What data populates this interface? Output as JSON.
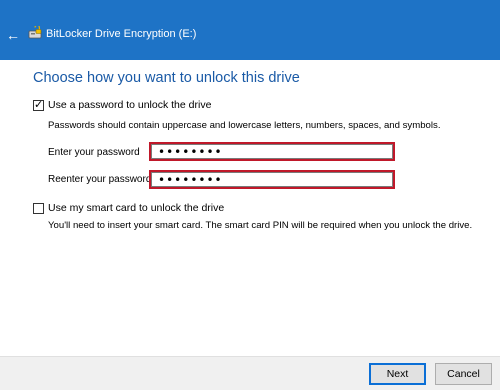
{
  "window": {
    "title": "BitLocker Drive Encryption (E:)"
  },
  "main": {
    "heading": "Choose how you want to unlock this drive",
    "password_option": {
      "label": "Use a password to unlock the drive",
      "checked": true,
      "description": "Passwords should contain uppercase and lowercase letters, numbers, spaces, and symbols.",
      "enter_label": "Enter your password",
      "enter_value": "••••••••",
      "reenter_label": "Reenter your password",
      "reenter_value": "••••••••"
    },
    "smartcard_option": {
      "label": "Use my smart card to unlock the drive",
      "checked": false,
      "description": "You'll need to insert your smart card. The smart card PIN will be required when you unlock the drive."
    }
  },
  "footer": {
    "next_label": "Next",
    "cancel_label": "Cancel"
  },
  "colors": {
    "titlebar": "#1e73c6",
    "heading": "#1a5aa6",
    "highlight": "#c0182a",
    "primary_border": "#0b6fd6"
  },
  "icons": {
    "back": "back-arrow-icon",
    "app": "bitlocker-drive-icon"
  }
}
